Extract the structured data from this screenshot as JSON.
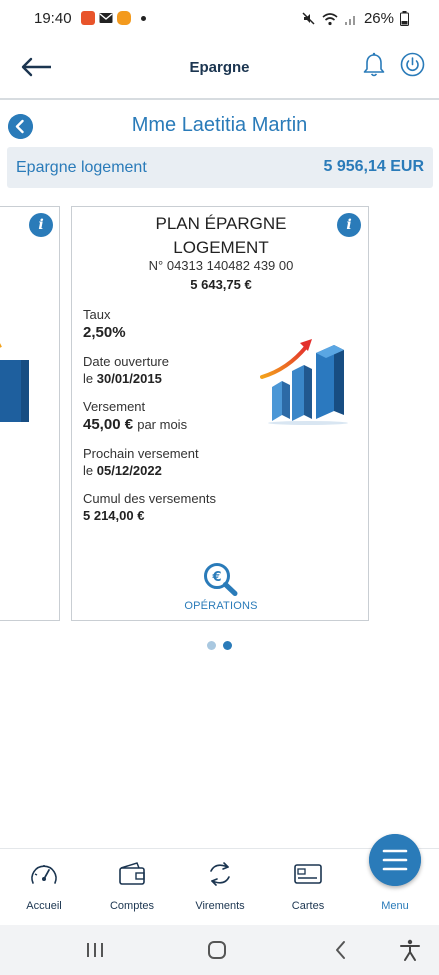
{
  "status_bar": {
    "time": "19:40",
    "battery": "26%",
    "icons": [
      "notification-app-icon",
      "mail-icon",
      "notification-app-icon",
      "dot-icon",
      "mute-icon",
      "wifi-icon",
      "signal-icon",
      "battery-icon"
    ]
  },
  "header": {
    "title": "Epargne",
    "icons": [
      "back-arrow-icon",
      "bell-icon",
      "power-icon"
    ]
  },
  "owner": {
    "name": "Mme Laetitia Martin",
    "icon": "chevron-left-icon"
  },
  "category": {
    "label": "Epargne logement",
    "total": "5 956,14 EUR"
  },
  "account_card": {
    "title_line1": "PLAN ÉPARGNE",
    "title_line2": "LOGEMENT",
    "number": "N° 04313 140482 439 00",
    "balance": "5 643,75 €",
    "rate_label": "Taux",
    "rate_value": "2,50%",
    "open_date_label": "Date ouverture",
    "open_date_prefix": "le",
    "open_date_value": "30/01/2015",
    "deposit_label": "Versement",
    "deposit_value": "45,00 €",
    "deposit_suffix": "par mois",
    "next_deposit_label": "Prochain versement",
    "next_deposit_prefix": "le",
    "next_deposit_value": "05/12/2022",
    "cumulative_label": "Cumul des versements",
    "cumulative_value": "5 214,00 €",
    "operations_label": "OPÉRATIONS",
    "icons": [
      "info-icon",
      "growth-chart-icon",
      "euro-search-icon"
    ]
  },
  "pager": {
    "pages": 2,
    "active_page": 2
  },
  "bottom_nav": {
    "items": [
      {
        "label": "Accueil",
        "icon": "speedometer-icon"
      },
      {
        "label": "Comptes",
        "icon": "wallet-icon"
      },
      {
        "label": "Virements",
        "icon": "transfer-icon"
      },
      {
        "label": "Cartes",
        "icon": "card-icon"
      },
      {
        "label": "Menu",
        "icon": "menu-icon"
      }
    ]
  },
  "colors": {
    "primary": "#2a7bb9",
    "dark_text": "#1b3550",
    "category_bg": "#e9eef3",
    "dot_inactive": "#a9c8e0",
    "accent_orange": "#f3a21b",
    "accent_red": "#e3302d"
  }
}
